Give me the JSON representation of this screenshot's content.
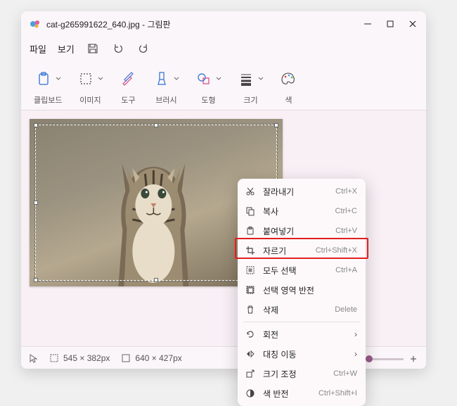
{
  "titlebar": {
    "filename": "cat-g265991622_640.jpg",
    "app_name": "그림판"
  },
  "menubar": {
    "file": "파일",
    "view": "보기"
  },
  "ribbon": {
    "clipboard": "클립보드",
    "image": "이미지",
    "tools": "도구",
    "brushes": "브러시",
    "shapes": "도형",
    "size": "크기",
    "colors": "색"
  },
  "statusbar": {
    "selection_size": "545 × 382px",
    "canvas_size": "640 × 427px"
  },
  "context_menu": {
    "cut": {
      "label": "잘라내기",
      "shortcut": "Ctrl+X"
    },
    "copy": {
      "label": "복사",
      "shortcut": "Ctrl+C"
    },
    "paste": {
      "label": "붙여넣기",
      "shortcut": "Ctrl+V"
    },
    "crop": {
      "label": "자르기",
      "shortcut": "Ctrl+Shift+X"
    },
    "select_all": {
      "label": "모두 선택",
      "shortcut": "Ctrl+A"
    },
    "invert_selection": {
      "label": "선택 영역 반전"
    },
    "delete": {
      "label": "삭제",
      "shortcut": "Delete"
    },
    "rotate": {
      "label": "회전"
    },
    "flip": {
      "label": "대칭 이동"
    },
    "resize": {
      "label": "크기 조정",
      "shortcut": "Ctrl+W"
    },
    "invert_colors": {
      "label": "색 반전",
      "shortcut": "Ctrl+Shift+I"
    }
  }
}
